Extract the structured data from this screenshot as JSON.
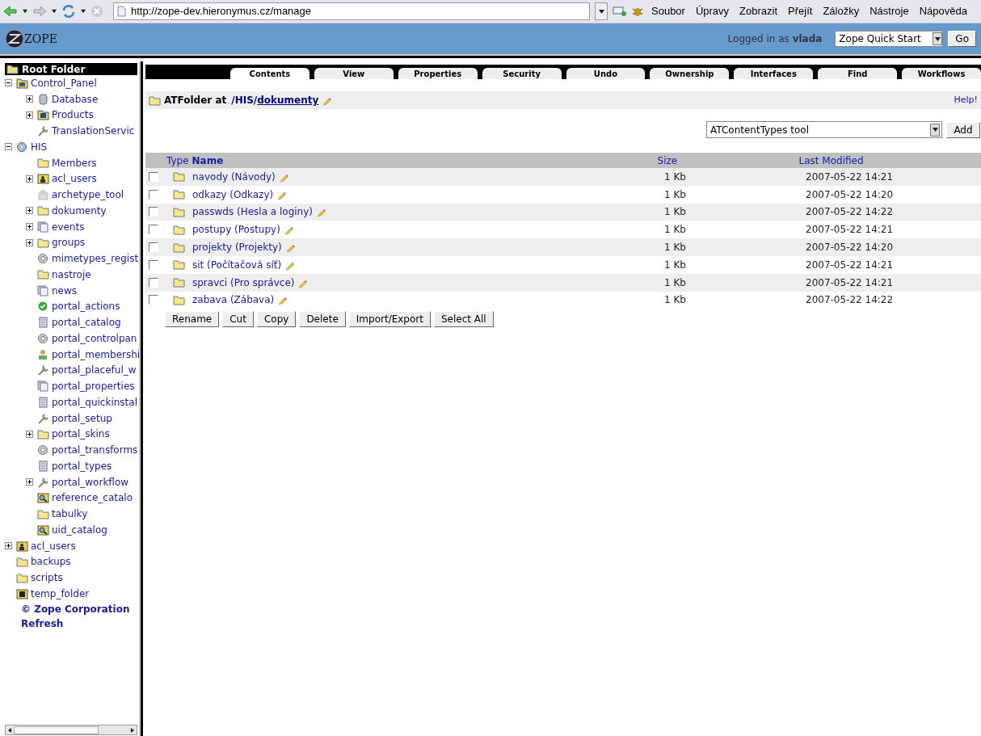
{
  "browser": {
    "url": "http://zope-dev.hieronymus.cz/manage",
    "menu": [
      "Soubor",
      "Úpravy",
      "Zobrazit",
      "Přejít",
      "Záložky",
      "Nástroje",
      "Nápověda"
    ]
  },
  "header": {
    "logo": "ZOPE",
    "login": "Logged in as **vlada**",
    "quick_select": "Zope Quick Start",
    "go": "Go"
  },
  "tree": {
    "root": "Root Folder",
    "items": [
      {
        "label": "Control_Panel",
        "kind": "panel",
        "expanded": true,
        "children": [
          {
            "label": "Database",
            "kind": "database",
            "expanded": false
          },
          {
            "label": "Products",
            "kind": "box",
            "expanded": false
          },
          {
            "label": "TranslationServic",
            "kind": "tool"
          }
        ]
      },
      {
        "label": "HIS",
        "kind": "site",
        "expanded": true,
        "children": [
          {
            "label": "Members",
            "kind": "folder"
          },
          {
            "label": "acl_users",
            "kind": "users",
            "expanded": false
          },
          {
            "label": "archetype_tool",
            "kind": "building"
          },
          {
            "label": "dokumenty",
            "kind": "folder",
            "expanded": false
          },
          {
            "label": "events",
            "kind": "pages",
            "expanded": false
          },
          {
            "label": "groups",
            "kind": "folder",
            "expanded": false
          },
          {
            "label": "mimetypes_regist",
            "kind": "circle"
          },
          {
            "label": "nastroje",
            "kind": "folder"
          },
          {
            "label": "news",
            "kind": "pages"
          },
          {
            "label": "portal_actions",
            "kind": "check"
          },
          {
            "label": "portal_catalog",
            "kind": "document"
          },
          {
            "label": "portal_controlpan",
            "kind": "circle"
          },
          {
            "label": "portal_membershi",
            "kind": "person"
          },
          {
            "label": "portal_placeful_w",
            "kind": "tool"
          },
          {
            "label": "portal_properties",
            "kind": "pages"
          },
          {
            "label": "portal_quickinstal",
            "kind": "document"
          },
          {
            "label": "portal_setup",
            "kind": "tool"
          },
          {
            "label": "portal_skins",
            "kind": "folder",
            "expanded": false
          },
          {
            "label": "portal_transforms",
            "kind": "circle"
          },
          {
            "label": "portal_types",
            "kind": "document"
          },
          {
            "label": "portal_workflow",
            "kind": "tool",
            "expanded": false
          },
          {
            "label": "reference_catalo",
            "kind": "search"
          },
          {
            "label": "tabulky",
            "kind": "folder"
          },
          {
            "label": "uid_catalog",
            "kind": "search"
          }
        ]
      },
      {
        "label": "acl_users",
        "kind": "users",
        "expanded": false
      },
      {
        "label": "backups",
        "kind": "folder"
      },
      {
        "label": "scripts",
        "kind": "folder"
      },
      {
        "label": "temp_folder",
        "kind": "temp"
      }
    ],
    "footer": [
      "© Zope Corporation",
      "Refresh"
    ]
  },
  "tabs": [
    {
      "label": "Contents",
      "selected": true
    },
    {
      "label": "View",
      "selected": false
    },
    {
      "label": "Properties",
      "selected": false
    },
    {
      "label": "Security",
      "selected": false
    },
    {
      "label": "Undo",
      "selected": false
    },
    {
      "label": "Ownership",
      "selected": false
    },
    {
      "label": "Interfaces",
      "selected": false
    },
    {
      "label": "Find",
      "selected": false
    },
    {
      "label": "Workflows",
      "selected": false
    }
  ],
  "location": {
    "prefix": "ATFolder at",
    "path": "/HIS/",
    "current": "dokumenty",
    "help": "Help!"
  },
  "add": {
    "value": "ATContentTypes tool",
    "button": "Add"
  },
  "table": {
    "columns": [
      "Type",
      "Name",
      "Size",
      "Last Modified"
    ],
    "rows": [
      {
        "checked": false,
        "name": "navody (Návody)",
        "size": "1 Kb",
        "modified": "2007-05-22 14:21"
      },
      {
        "checked": false,
        "name": "odkazy (Odkazy)",
        "size": "1 Kb",
        "modified": "2007-05-22 14:20"
      },
      {
        "checked": false,
        "name": "passwds (Hesla a loginy)",
        "size": "1 Kb",
        "modified": "2007-05-22 14:22"
      },
      {
        "checked": false,
        "name": "postupy (Postupy)",
        "size": "1 Kb",
        "modified": "2007-05-22 14:21"
      },
      {
        "checked": false,
        "name": "projekty (Projekty)",
        "size": "1 Kb",
        "modified": "2007-05-22 14:20"
      },
      {
        "checked": false,
        "name": "sit (Počítačová síť)",
        "size": "1 Kb",
        "modified": "2007-05-22 14:21"
      },
      {
        "checked": false,
        "name": "spravci (Pro správce)",
        "size": "1 Kb",
        "modified": "2007-05-22 14:21"
      },
      {
        "checked": false,
        "name": "zabava (Zábava)",
        "size": "1 Kb",
        "modified": "2007-05-22 14:22"
      }
    ]
  },
  "buttons": [
    "Rename",
    "Cut",
    "Copy",
    "Delete",
    "Import/Export",
    "Select All"
  ]
}
